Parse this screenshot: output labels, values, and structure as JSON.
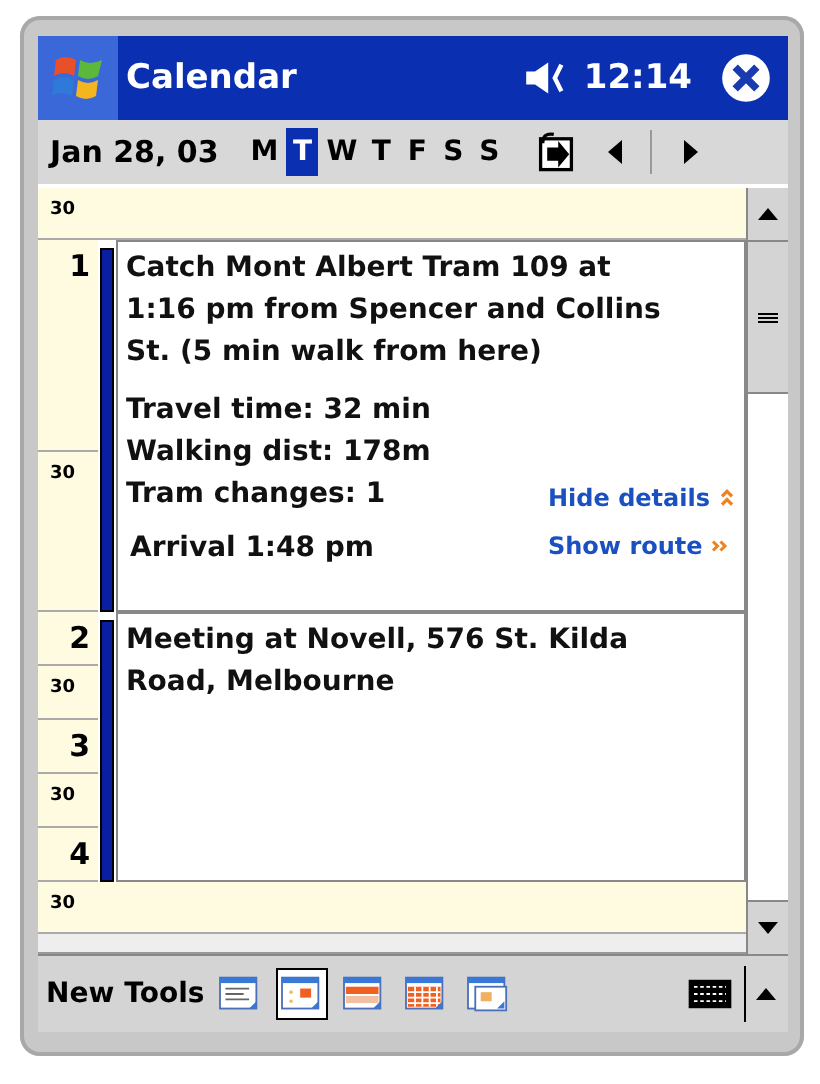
{
  "title_bar": {
    "title": "Calendar",
    "time": "12:14"
  },
  "toolbar": {
    "date": "Jan 28, 03",
    "days": [
      {
        "label": "M",
        "selected": false
      },
      {
        "label": "T",
        "selected": true
      },
      {
        "label": "W",
        "selected": false
      },
      {
        "label": "T",
        "selected": false
      },
      {
        "label": "F",
        "selected": false
      },
      {
        "label": "S",
        "selected": false
      },
      {
        "label": "S",
        "selected": false
      }
    ]
  },
  "slots": [
    {
      "label": "30",
      "kind": "half",
      "free": true
    },
    {
      "label": "1",
      "kind": "hour",
      "free": false
    },
    {
      "label": "30",
      "kind": "half",
      "free": false
    },
    {
      "label": "2",
      "kind": "hour",
      "free": false
    },
    {
      "label": "30",
      "kind": "half",
      "free": false
    },
    {
      "label": "3",
      "kind": "hour",
      "free": false
    },
    {
      "label": "30",
      "kind": "half",
      "free": false
    },
    {
      "label": "4",
      "kind": "hour",
      "free": false
    },
    {
      "label": "30",
      "kind": "half",
      "free": true
    }
  ],
  "events": [
    {
      "title": "Catch Mont Albert Tram 109 at 1:16 pm from Spencer and Collins St. (5 min walk from here)",
      "details": [
        "Travel time: 32 min",
        "Walking dist: 178m",
        "Tram changes: 1"
      ],
      "arrival": "Arrival 1:48 pm",
      "links": [
        "Hide details",
        "Show route"
      ]
    },
    {
      "title": "Meeting at Novell, 576 St. Kilda Road, Melbourne"
    }
  ],
  "menu_bar": {
    "items": [
      "New",
      "Tools"
    ],
    "views": [
      {
        "kind": "agenda",
        "selected": false
      },
      {
        "kind": "day",
        "selected": true
      },
      {
        "kind": "week",
        "selected": false
      },
      {
        "kind": "month",
        "selected": false
      },
      {
        "kind": "year",
        "selected": false
      }
    ]
  }
}
